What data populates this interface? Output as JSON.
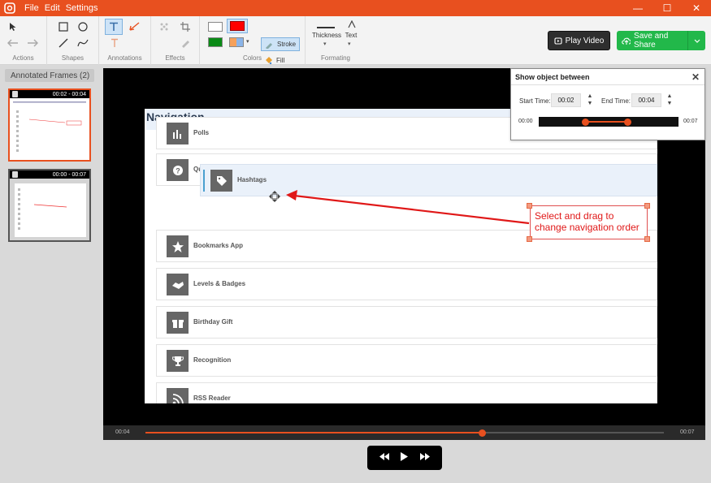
{
  "menu": {
    "file": "File",
    "edit": "Edit",
    "settings": "Settings"
  },
  "window_controls": {
    "minimize": "—",
    "maximize": "☐",
    "close": "✕"
  },
  "toolbar": {
    "groups": {
      "actions": "Actions",
      "shapes": "Shapes",
      "annotations": "Annotations",
      "effects": "Effects",
      "colors": "Colors",
      "formatting": "Formating"
    },
    "stroke_label": "Stroke",
    "fill_label": "Fill",
    "thickness_label": "Thickness",
    "text_label": "Text",
    "play_video": "Play Video",
    "save_and_share": "Save and Share"
  },
  "colors": {
    "accent": "#e8501f",
    "save_green": "#22b84a",
    "stroke_red": "#ff0000",
    "fill_green": "#0a8a16"
  },
  "sidebar": {
    "header": "Annotated Frames (2)",
    "frames": [
      {
        "range": "00:02 - 00:04"
      },
      {
        "range": "00:00 - 00:07"
      }
    ]
  },
  "video": {
    "page_title": "Navigation",
    "rows": [
      {
        "label": "Polls",
        "icon": "bar-chart-icon"
      },
      {
        "label": "Qu",
        "icon": "question-icon"
      },
      {
        "label": "Bookmarks App",
        "icon": "star-icon"
      },
      {
        "label": "Levels & Badges",
        "icon": "handshake-icon"
      },
      {
        "label": "Birthday Gift",
        "icon": "gift-icon"
      },
      {
        "label": "Recognition",
        "icon": "trophy-icon"
      },
      {
        "label": "RSS Reader",
        "icon": "rss-icon"
      }
    ],
    "drag_row": {
      "label": "Hashtags",
      "icon": "tag-icon"
    }
  },
  "callout": {
    "text": "Select and drag to change navigation order"
  },
  "popup": {
    "title": "Show object between",
    "start_label": "Start Time:",
    "start_value": "00:02",
    "end_label": "End Time:",
    "end_value": "00:04",
    "range_min": "00:00",
    "range_max": "00:07"
  },
  "timeline": {
    "current": "00:04",
    "total": "00:07",
    "progress": 0.65
  }
}
